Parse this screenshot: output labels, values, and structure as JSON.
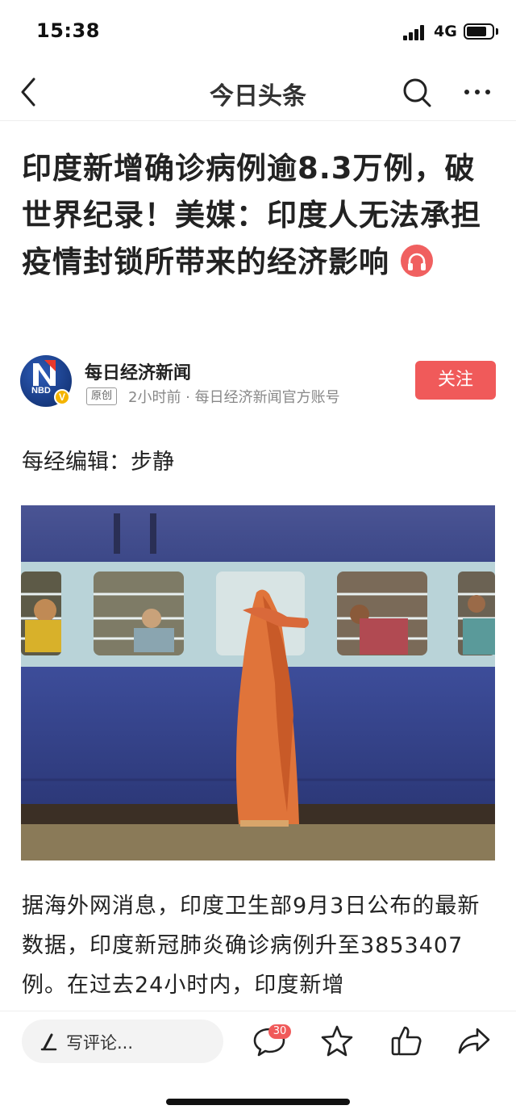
{
  "status_bar": {
    "time": "15:38",
    "network": "4G",
    "icons": [
      "signal-icon",
      "battery-icon"
    ]
  },
  "nav": {
    "title": "今日头条",
    "icons": [
      "back-icon",
      "search-icon",
      "more-icon"
    ]
  },
  "article": {
    "title": "印度新增确诊病例逾8.3万例，破世界纪录！美媒：印度人无法承担疫情封锁所带来的经济影响",
    "author": {
      "name": "每日经济新闻",
      "avatar_text": "NBD",
      "verified_mark": "V",
      "badge": "原创",
      "meta": "2小时前 · 每日经济新闻官方账号",
      "follow_label": "关注"
    },
    "editor": "每经编辑：步静",
    "body": "据海外网消息，印度卫生部9月3日公布的最新数据，印度新冠肺炎确诊病例升至3853407例。在过去24小时内，印度新增"
  },
  "bottom_bar": {
    "comment_placeholder": "写评论...",
    "comment_count": "30",
    "icons": [
      "pen-icon",
      "comment-icon",
      "star-icon",
      "thumbs-up-icon",
      "share-icon"
    ]
  },
  "colors": {
    "accent": "#f05a5a",
    "text": "#222222",
    "meta": "#888888"
  }
}
